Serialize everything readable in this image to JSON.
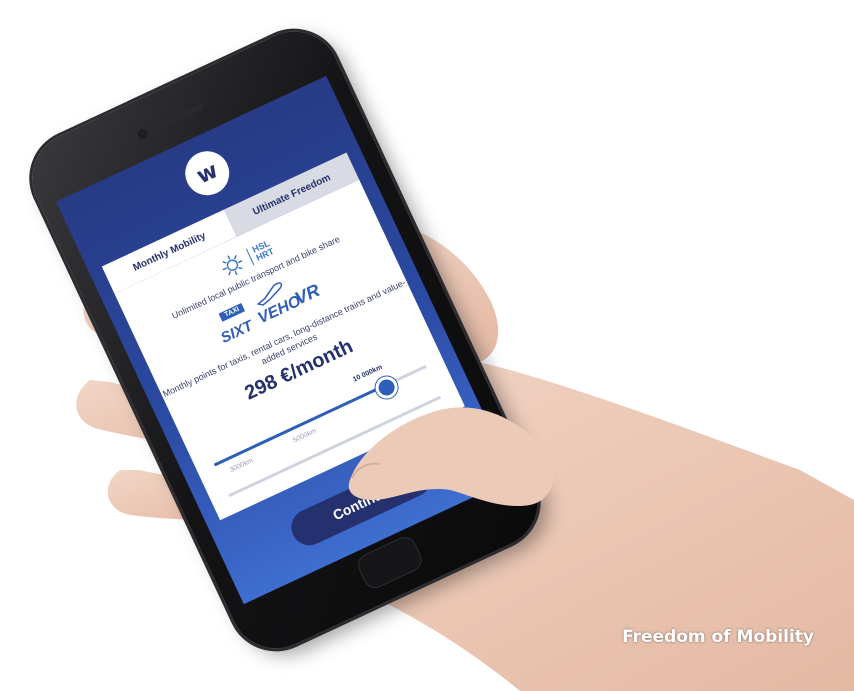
{
  "app": {
    "logo_glyph": "w",
    "tabs": [
      {
        "label": "Monthly Mobility",
        "active": true
      },
      {
        "label": "Ultimate Freedom",
        "active": false
      }
    ]
  },
  "plan": {
    "hsl_logo": "HSL\nHRT",
    "local_transport_text": "Unlimited local public transport and bike share",
    "brands": {
      "taxi": "TAXI",
      "sixt": "SIXT",
      "veho": "VEHO",
      "vr": "VR"
    },
    "points_text": "Monthly points for taxis, rental cars, long-distance trains and value-added services",
    "price": "298 €/month"
  },
  "slider": {
    "labels": [
      "3000km",
      "5000km",
      "10 000km"
    ],
    "selected_label": "10 000km",
    "value_fraction": 0.8
  },
  "continue_label": "Continue",
  "tagline": "Freedom of Mobility",
  "colors": {
    "primary": "#25306e",
    "accent": "#2e5fb8",
    "screen_top": "#273b86",
    "screen_bottom": "#3f6ed1"
  },
  "icons": [
    "sun-icon",
    "airplane-icon"
  ]
}
